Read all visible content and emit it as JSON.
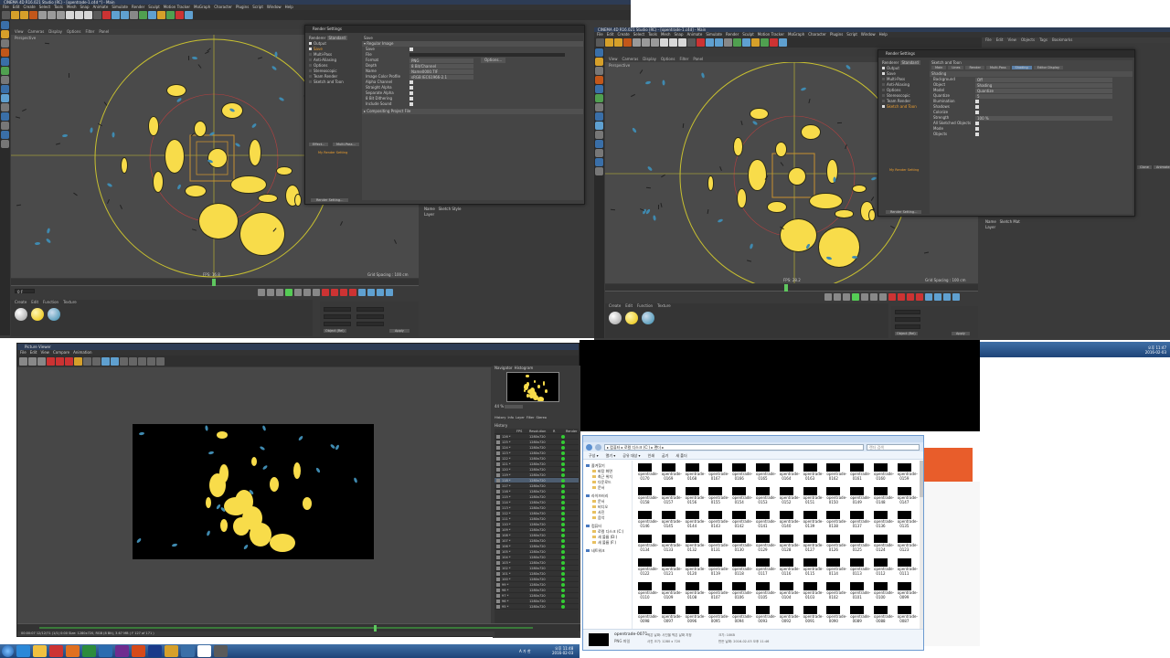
{
  "left_c4d": {
    "title": "CINEMA 4D R16.021 Studio (RC) - [opentrade-1.c4d *] - Main",
    "menu": [
      "File",
      "Edit",
      "Create",
      "Select",
      "Tools",
      "Mesh",
      "Snap",
      "Animate",
      "Simulate",
      "Render",
      "Sculpt",
      "Motion Tracker",
      "MoGraph",
      "Character",
      "Plugins",
      "Script",
      "Window",
      "Help"
    ],
    "layout_label": "Layout:",
    "layout_value": "Startup (User)",
    "viewport_menu": [
      "View",
      "Cameras",
      "Display",
      "Options",
      "Filter",
      "Panel"
    ],
    "viewport_label": "Perspective",
    "fps_label": "FPS: 16.8",
    "grid_label": "Grid Spacing : 100 cm",
    "frame_field": "0 F",
    "frame_end": "205 F",
    "material_menu": [
      "Create",
      "Edit",
      "Function",
      "Texture"
    ],
    "coord_labels": [
      "X",
      "Y",
      "Z"
    ],
    "coord_values": [
      "0 cm",
      "0 cm",
      "0 cm"
    ],
    "object_rel": "Object (Rel)",
    "size_label": "Size",
    "apply": "Apply"
  },
  "left_rs": {
    "title": "Render Settings",
    "renderer_label": "Renderer",
    "renderer_value": "Standard",
    "sidebar": [
      "Output",
      "Save",
      "Multi-Pass",
      "Anti-Aliasing",
      "Options",
      "Stereoscopic",
      "Team Render",
      "Sketch and Toon"
    ],
    "tab": "Save",
    "section": "Regular Image",
    "save_label": "Save",
    "file_label": "File",
    "format_label": "Format",
    "format_value": "PNG",
    "options_btn": "Options...",
    "depth_label": "Depth",
    "depth_value": "8 Bit/Channel",
    "name_label": "Name",
    "name_value": "Name0000.TIF",
    "profile_label": "Image Color Profile",
    "profile_value": "sRGB IEC61966-2.1",
    "alpha_label": "Alpha Channel",
    "straight_label": "Straight Alpha",
    "separate_label": "Separate Alpha",
    "dither_label": "8 Bit Dithering",
    "sound_label": "Include Sound",
    "compositing": "Compositing Project File",
    "effect_btn": "Effect...",
    "multipass_btn": "Multi-Pass...",
    "mysetting": "My Render Setting",
    "rs_button": "Render Setting..."
  },
  "left_attr": {
    "name_label": "Name",
    "name_value": "Sketch Style",
    "layer_label": "Layer"
  },
  "right_c4d": {
    "title": "CINEMA 4D R16.021 Studio (RC) - [opentrade-1.c4d] - Main",
    "menu": [
      "File",
      "Edit",
      "Create",
      "Select",
      "Tools",
      "Mesh",
      "Snap",
      "Animate",
      "Simulate",
      "Render",
      "Sculpt",
      "Motion Tracker",
      "MoGraph",
      "Character",
      "Plugins",
      "Script",
      "Window",
      "Help"
    ],
    "viewport_menu": [
      "View",
      "Cameras",
      "Display",
      "Options",
      "Filter",
      "Panel"
    ],
    "viewport_label": "Perspective",
    "fps_label": "FPS: 28.2",
    "grid_label": "Grid Spacing : 100 cm",
    "frame_field": "0 F",
    "material_menu": [
      "Create",
      "Edit",
      "Function",
      "Texture"
    ],
    "object_rel": "Object (Rel)",
    "apply": "Apply",
    "layout_value": "Startup (User)",
    "obj_menu": [
      "File",
      "Edit",
      "View",
      "Objects",
      "Tags",
      "Bookmarks"
    ]
  },
  "right_rs": {
    "title": "Render Settings",
    "renderer_label": "Renderer",
    "renderer_value": "Standard",
    "sidebar": [
      "Output",
      "Save",
      "Multi-Pass",
      "Anti-Aliasing",
      "Options",
      "Stereoscopic",
      "Team Render",
      "Sketch and Toon"
    ],
    "section_title": "Sketch and Toon",
    "tabs": [
      "Main",
      "Lines",
      "Render",
      "Multi-Pass",
      "Shading",
      "Editor Display"
    ],
    "shading": "Shading",
    "background_label": "Background",
    "background_value": "Off",
    "object_label": "Object",
    "object_value": "Shading",
    "model_label": "Model",
    "model_value": "Quantize",
    "quantize_label": "Quantize",
    "quantize_value": "5",
    "illumination_label": "Illumination",
    "shadows_label": "Shadows",
    "colorize_label": "Colorize",
    "strength_label": "Strength",
    "strength_value": "100 %",
    "all_sketched": "All Sketched Objects",
    "mode": "Mode",
    "objects": "Objects",
    "mysetting": "My Render Setting",
    "rs_button": "Render Setting...",
    "clone_btns": [
      "Clone",
      "Animate"
    ],
    "name_label": "Name",
    "name_value": "Sketch Mat",
    "layer_label": "Layer"
  },
  "picture_viewer": {
    "title": "Picture Viewer",
    "menu": [
      "File",
      "Edit",
      "View",
      "Compare",
      "Animation"
    ],
    "nav_tabs": [
      "Navigator",
      "Histogram"
    ],
    "zoom": "44 %",
    "list_tabs": [
      "History",
      "Info",
      "Layer",
      "Filter",
      "Stereo"
    ],
    "history_label": "History",
    "list_header": [
      "",
      "FPS",
      "Resolution",
      "R",
      "Render"
    ],
    "rows": [
      {
        "name": "126 *",
        "res": "1280x720"
      },
      {
        "name": "125 *",
        "res": "1280x720"
      },
      {
        "name": "124 *",
        "res": "1280x720"
      },
      {
        "name": "123 *",
        "res": "1280x720"
      },
      {
        "name": "122 *",
        "res": "1280x720"
      },
      {
        "name": "121 *",
        "res": "1280x720"
      },
      {
        "name": "120 *",
        "res": "1280x720"
      },
      {
        "name": "119 *",
        "res": "1280x720"
      },
      {
        "name": "118 *",
        "res": "1280x720"
      },
      {
        "name": "117 *",
        "res": "1280x720"
      },
      {
        "name": "116 *",
        "res": "1280x720"
      },
      {
        "name": "115 *",
        "res": "1280x720"
      },
      {
        "name": "114 *",
        "res": "1280x720"
      },
      {
        "name": "113 *",
        "res": "1280x720"
      },
      {
        "name": "112 *",
        "res": "1280x720"
      },
      {
        "name": "111 *",
        "res": "1280x720"
      },
      {
        "name": "110 *",
        "res": "1280x720"
      },
      {
        "name": "109 *",
        "res": "1280x720"
      },
      {
        "name": "108 *",
        "res": "1280x720"
      },
      {
        "name": "107 *",
        "res": "1280x720"
      },
      {
        "name": "106 *",
        "res": "1280x720"
      },
      {
        "name": "105 *",
        "res": "1280x720"
      },
      {
        "name": "104 *",
        "res": "1280x720"
      },
      {
        "name": "103 *",
        "res": "1280x720"
      },
      {
        "name": "102 *",
        "res": "1280x720"
      },
      {
        "name": "101 *",
        "res": "1280x720"
      },
      {
        "name": "100 *",
        "res": "1280x720"
      },
      {
        "name": "99 *",
        "res": "1280x720"
      },
      {
        "name": "98 *",
        "res": "1280x720"
      },
      {
        "name": "97 *",
        "res": "1280x720"
      },
      {
        "name": "96 *",
        "res": "1280x720"
      },
      {
        "name": "95 *",
        "res": "1280x720"
      }
    ],
    "status": "00:00:07 12/12/71 (1/1)  0:00  Size: 1280x720, RGB (8 Bit), 3.67 MB  ( F 127 of 171 )"
  },
  "explorer": {
    "address": "▸ 컴퓨터 ▸ 로컬 디스크 (C:) ▸ 랜더 ▸",
    "search": "랜더 검색",
    "toolbar": [
      "구성 ▾",
      "열기 ▾",
      "공유 대상 ▾",
      "인쇄",
      "굽기",
      "새 폴더"
    ],
    "nav": [
      "즐겨찾기",
      "바탕 화면",
      "최근 위치",
      "다운로드",
      "문서",
      "라이브러리",
      "문서",
      "비디오",
      "사진",
      "음악",
      "컴퓨터",
      "로컬 디스크 (C:)",
      "새 볼륨 (D:)",
      "새 볼륨 (F:)",
      "네트워크"
    ],
    "files": [
      "0170",
      "0169",
      "0168",
      "0167",
      "0166",
      "0165",
      "0164",
      "0163",
      "0162",
      "0161",
      "0160",
      "0159",
      "0158",
      "0157",
      "0156",
      "0155",
      "0154",
      "0153",
      "0152",
      "0151",
      "0150",
      "0149",
      "0148",
      "0147",
      "0146",
      "0145",
      "0144",
      "0143",
      "0142",
      "0141",
      "0140",
      "0139",
      "0138",
      "0137",
      "0136",
      "0135",
      "0134",
      "0133",
      "0132",
      "0131",
      "0130",
      "0129",
      "0128",
      "0127",
      "0126",
      "0125",
      "0124",
      "0123",
      "0122",
      "0121",
      "0120",
      "0119",
      "0118",
      "0117",
      "0116",
      "0115",
      "0114",
      "0113",
      "0112",
      "0111",
      "0110",
      "0109",
      "0108",
      "0107",
      "0106",
      "0105",
      "0104",
      "0103",
      "0102",
      "0101",
      "0100",
      "0099",
      "0098",
      "0097",
      "0096",
      "0095",
      "0094",
      "0093",
      "0092",
      "0091",
      "0090",
      "0089",
      "0088",
      "0087"
    ],
    "file_prefix": "opentrade-",
    "details_name": "opentrade-0071",
    "details_type": "PNG 파일",
    "details_taken": "찍은 날짜: 사진을 찍은 날짜 지정",
    "details_dim": "사진 크기: 1280 x 720",
    "details_size": "크기: 10KB",
    "details_date": "만든 날짜: 2016-02-03 오후 11:46"
  },
  "taskbar_left": {
    "time": "오후 11:48",
    "date": "2016-02-03",
    "lang": "A 가 한"
  },
  "taskbar_right": {
    "time": "오후 11:47",
    "date": "2016-02-03"
  },
  "colors": {
    "coin": "#f8dc4a",
    "viewport": "#4a4a4a",
    "orange": "#f0a030",
    "web_orange": "#e85d2b"
  }
}
